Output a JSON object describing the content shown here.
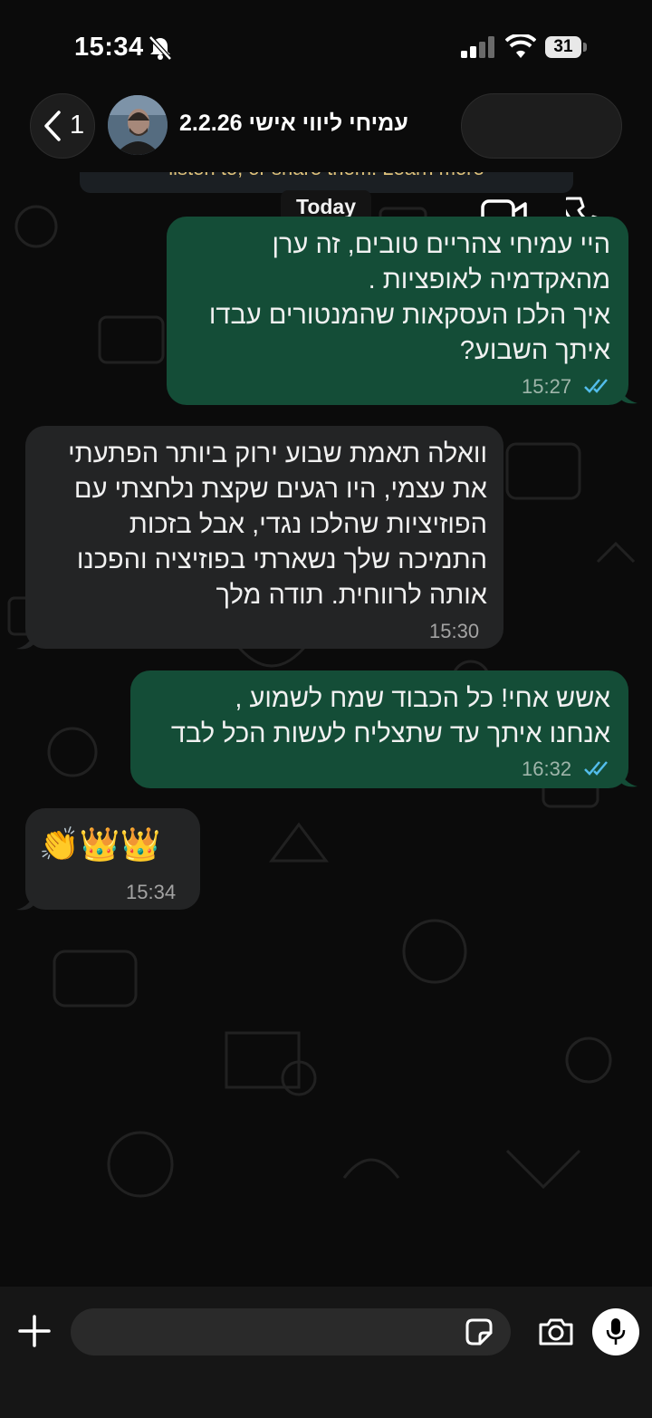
{
  "status_bar": {
    "time": "15:34",
    "battery": "31"
  },
  "header": {
    "back_count": "1",
    "contact_name": "עמיחי ליווי אישי 2.2.26"
  },
  "notice": {
    "text": "listen to, or share them. Learn more"
  },
  "date_chip": "Today",
  "messages": [
    {
      "direction": "out",
      "text": "היי עמיחי צהריים טובים, זה ערן\nמהאקדמיה לאופציות .\nאיך הלכו העסקאות שהמנטורים עבדו\nאיתך השבוע?",
      "time": "15:27",
      "status": "read"
    },
    {
      "direction": "in",
      "text": "וואלה תאמת שבוע ירוק ביותר הפתעתי\nאת עצמי, היו רגעים שקצת נלחצתי עם\nהפוזיציות שהלכו נגדי, אבל בזכות\nהתמיכה שלך נשארתי בפוזיציה והפכנו\nאותה לרווחית.  תודה מלך",
      "time": "15:30"
    },
    {
      "direction": "out",
      "text": "אשש אחי! כל הכבוד שמח לשמוע ,\nאנחנו איתך עד שתצליח לעשות הכל לבד",
      "time": "16:32",
      "status": "read"
    },
    {
      "direction": "in",
      "text": "👏👑👑",
      "time": "15:34"
    }
  ],
  "colors": {
    "outgoing": "#144d37",
    "incoming": "#232425",
    "read_ticks": "#53bdeb",
    "notice": "#e0c37c"
  },
  "icons": [
    "bell-slash-icon",
    "signal-icon",
    "wifi-icon",
    "battery-icon",
    "chevron-left-icon",
    "video-camera-icon",
    "phone-icon",
    "plus-icon",
    "sticker-icon",
    "camera-icon",
    "microphone-icon"
  ]
}
